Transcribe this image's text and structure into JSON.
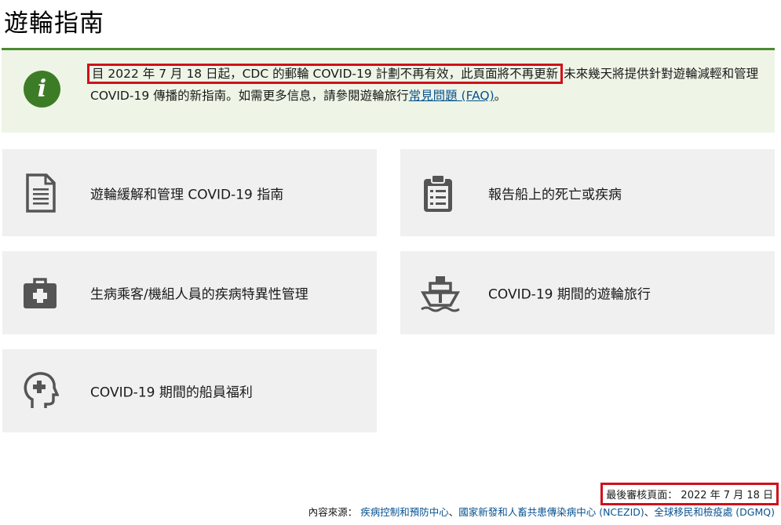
{
  "page": {
    "title": "遊輪指南"
  },
  "notice": {
    "highlighted": "目 2022 年 7 月 18 日起，CDC 的郵輪 COVID-19 計劃不再有效，此頁面將不再更新",
    "text_before_link": " 未來幾天將提供針對遊輪減輕和管理 COVID-19 傳播的新指南。如需更多信息，請參閱遊輪旅行",
    "link": "常見問題 (FAQ)",
    "text_after_link": "。",
    "icon": "info-icon"
  },
  "cards": [
    {
      "label": "遊輪緩解和管理 COVID-19 指南",
      "icon": "document-icon"
    },
    {
      "label": "報告船上的死亡或疾病",
      "icon": "clipboard-icon"
    },
    {
      "label": "生病乘客/機組人員的疾病特異性管理",
      "icon": "medical-kit-icon"
    },
    {
      "label": "COVID-19 期間的遊輪旅行",
      "icon": "ship-icon"
    },
    {
      "label": "COVID-19 期間的船員福利",
      "icon": "head-medical-icon"
    }
  ],
  "footer": {
    "last_reviewed": "最後審核頁面： 2022 年 7 月 18 日",
    "source_label": "內容來源：",
    "source_links": [
      "疾病控制和預防中心",
      "國家新發和人畜共患傳染病中心 (NCEZID)",
      "全球移民和檢疫處 (DGMQ)"
    ]
  },
  "colors": {
    "accent_green": "#4b8a2e",
    "highlight_red": "#d0101b",
    "link_blue": "#075290",
    "card_bg": "#f0f0f0"
  }
}
